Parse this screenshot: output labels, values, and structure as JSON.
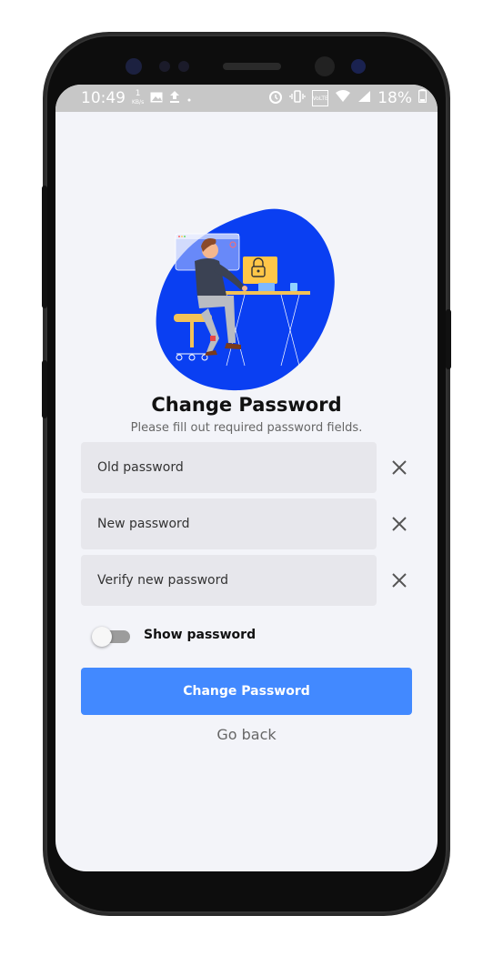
{
  "status_bar": {
    "time": "10:49",
    "net_speed_value": "1",
    "net_speed_unit": "KB/s",
    "lte_badge": "VoLTE",
    "battery": "18%"
  },
  "form": {
    "title": "Change Password",
    "subtitle": "Please fill out required password fields.",
    "old_placeholder": "Old password",
    "new_placeholder": "New password",
    "verify_placeholder": "Verify new password",
    "show_password_label": "Show password",
    "show_password_on": false,
    "submit_label": "Change Password",
    "back_label": "Go back"
  },
  "icons": {
    "clear": "close-icon",
    "alarm": "alarm-icon",
    "vibrate": "vibrate-icon",
    "wifi": "wifi-icon",
    "signal": "signal-icon",
    "battery": "battery-icon",
    "image": "image-icon",
    "upload": "upload-icon"
  },
  "colors": {
    "accent": "#4289ff",
    "illustration_blob": "#0a3ff2",
    "screen_bg": "#f3f4f9",
    "field_bg": "#e7e7ec"
  }
}
